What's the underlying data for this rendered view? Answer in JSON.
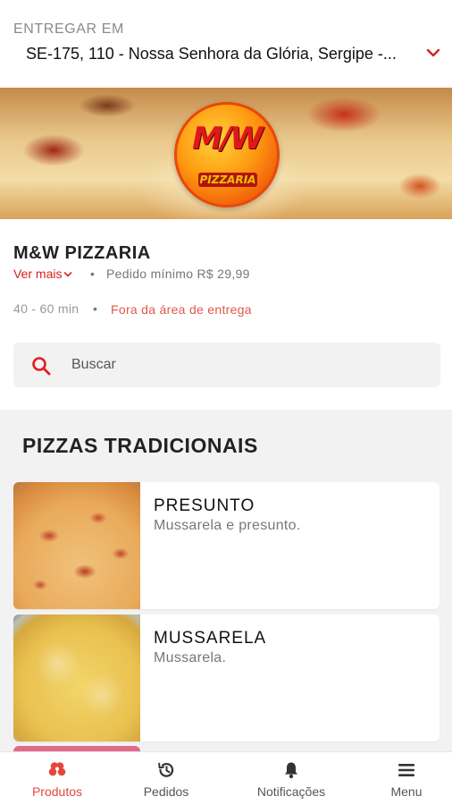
{
  "header": {
    "deliver_label": "ENTREGAR EM",
    "address": "SE-175, 110 - Nossa Senhora da Glória, Sergipe -..."
  },
  "banner": {
    "logo_text": "M/W",
    "logo_subtitle": "PIZZARIA"
  },
  "store": {
    "name": "M&W PIZZARIA",
    "see_more": "Ver mais",
    "separator": "•",
    "min_order": "Pedido mínimo R$ 29,99",
    "delivery_time": "40 - 60 min",
    "delivery_status": "Fora da área de entrega"
  },
  "search": {
    "placeholder": "Buscar"
  },
  "section": {
    "title": "PIZZAS TRADICIONAIS",
    "products": [
      {
        "name": "PRESUNTO",
        "description": "Mussarela e presunto."
      },
      {
        "name": "MUSSARELA",
        "description": "Mussarela."
      }
    ]
  },
  "nav": {
    "items": [
      {
        "label": "Produtos",
        "icon": "pizza-slices-icon",
        "active": true
      },
      {
        "label": "Pedidos",
        "icon": "history-icon",
        "active": false
      },
      {
        "label": "Notificações",
        "icon": "bell-icon",
        "active": false
      },
      {
        "label": "Menu",
        "icon": "hamburger-menu-icon",
        "active": false
      }
    ]
  },
  "colors": {
    "accent": "#d8201e",
    "active_nav": "#e4483c",
    "warning_text": "#e0584a",
    "muted_text": "#777777",
    "background": "#f2f2f2"
  }
}
